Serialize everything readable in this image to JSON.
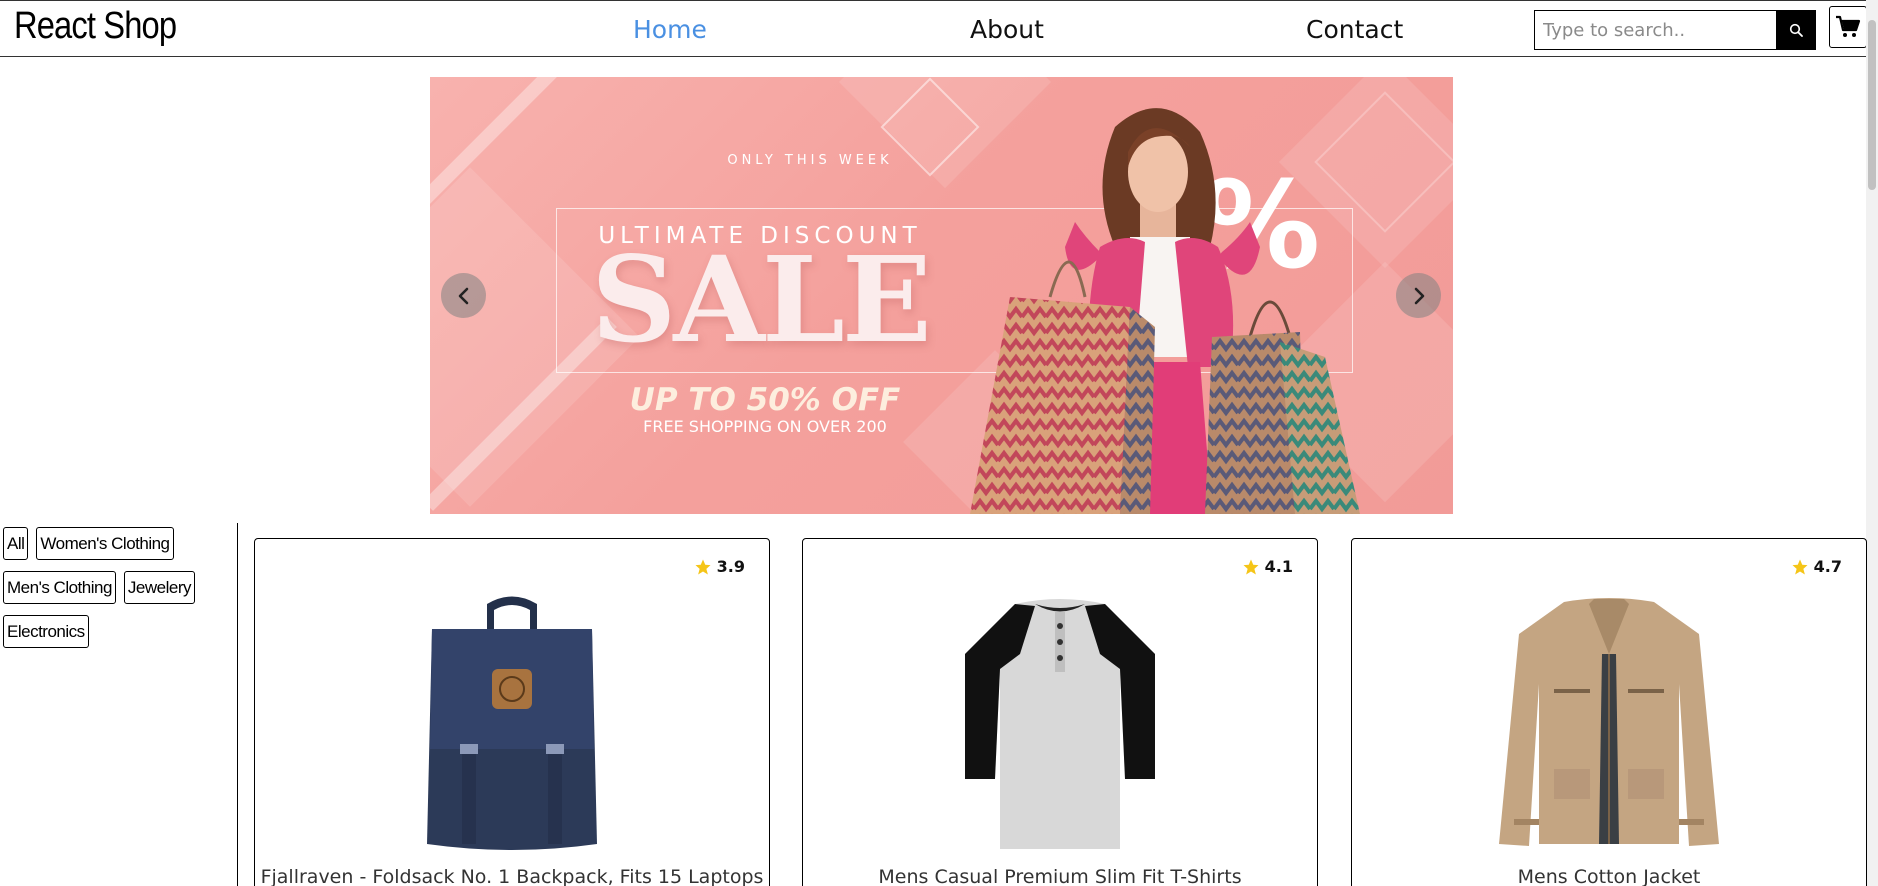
{
  "navbar": {
    "brand": "React Shop",
    "links": [
      {
        "label": "Home",
        "active": true
      },
      {
        "label": "About",
        "active": false
      },
      {
        "label": "Contact",
        "active": false
      }
    ],
    "search": {
      "placeholder": "Type to search..",
      "value": "",
      "icon": "search-icon"
    },
    "cart_icon": "cart-icon",
    "active_link_color": "#4a90e2"
  },
  "banner": {
    "tagline": "ONLY THIS WEEK",
    "subtitle": "ULTIMATE DISCOUNT",
    "headline": "SALE",
    "offer": "UP TO 50% OFF",
    "note": "FREE SHOPPING ON OVER 200",
    "percent_sign": "%",
    "prev_icon": "chevron-left-icon",
    "next_icon": "chevron-right-icon",
    "background_color": "#f4a09c"
  },
  "categories": {
    "rows": [
      [
        "All",
        "Women's Clothing"
      ],
      [
        "Men's Clothing",
        "Jewelery"
      ],
      [
        "Electronics"
      ]
    ]
  },
  "products": [
    {
      "rating": "3.9",
      "title": "Fjallraven - Foldsack No. 1 Backpack, Fits 15 Laptops",
      "image": "backpack"
    },
    {
      "rating": "4.1",
      "title": "Mens Casual Premium Slim Fit T-Shirts",
      "image": "raglan-shirt"
    },
    {
      "rating": "4.7",
      "title": "Mens Cotton Jacket",
      "image": "cotton-jacket"
    }
  ],
  "star_color": "#f5c518"
}
